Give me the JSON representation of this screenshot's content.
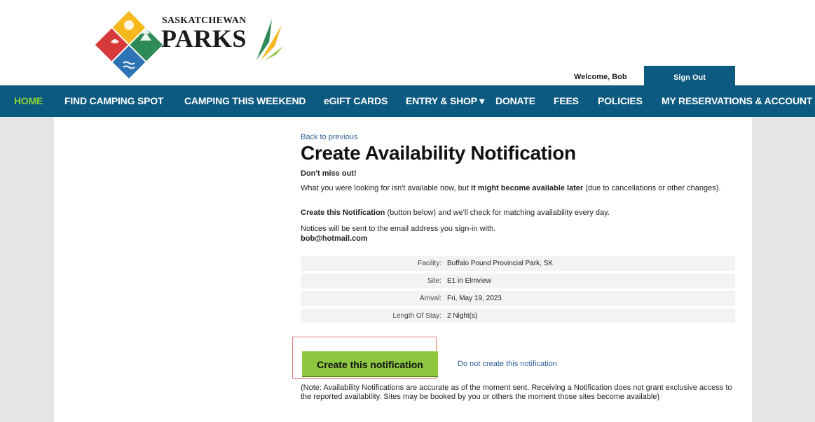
{
  "brand": {
    "line1": "SASKATCHEWAN",
    "line2": "PARKS",
    "colors": {
      "red": "#d63a3a",
      "yellow": "#f6b81d",
      "green": "#2e8b57",
      "blue": "#2d74b5",
      "accent_green": "#8dc63f"
    }
  },
  "header": {
    "welcome": "Welcome, Bob",
    "sign_out": "Sign Out"
  },
  "nav": {
    "items": [
      {
        "label": "HOME",
        "active": true
      },
      {
        "label": "FIND CAMPING SPOT"
      },
      {
        "label": "CAMPING THIS WEEKEND"
      },
      {
        "label": "eGIFT CARDS"
      },
      {
        "label": "ENTRY & SHOP ▾"
      },
      {
        "label": "DONATE"
      },
      {
        "label": "FEES"
      },
      {
        "label": "POLICIES"
      },
      {
        "label": "MY RESERVATIONS & ACCOUNT"
      }
    ]
  },
  "main": {
    "back_link": "Back to previous",
    "title": "Create Availability Notification",
    "dont_miss": "Don't miss out!",
    "intro_a": "What you were looking for isn't available now, but ",
    "intro_b": "it might become available later",
    "intro_c": " (due to cancellations or other changes).",
    "create_a": "Create this Notification",
    "create_b": " (button below) and we'll check for matching availability every day.",
    "notices": "Notices will be sent to the email address you sign-in with.",
    "email": "bob@hotmail.com"
  },
  "details": [
    {
      "label": "Facility:",
      "value": "Buffalo Pound Provincial Park, SK"
    },
    {
      "label": "Site:",
      "value": "E1 in Elmview"
    },
    {
      "label": "Arrival:",
      "value": "Fri, May 19, 2023"
    },
    {
      "label": "Length Of Stay:",
      "value": "2 Night(s)"
    }
  ],
  "actions": {
    "create": "Create this notification",
    "decline": "Do not create this notification"
  },
  "note": "(Note: Availability Notifications are accurate as of the moment sent. Receiving a Notification does not grant exclusive access to the reported availability. Sites may be booked by you or others the moment those sites become available)"
}
